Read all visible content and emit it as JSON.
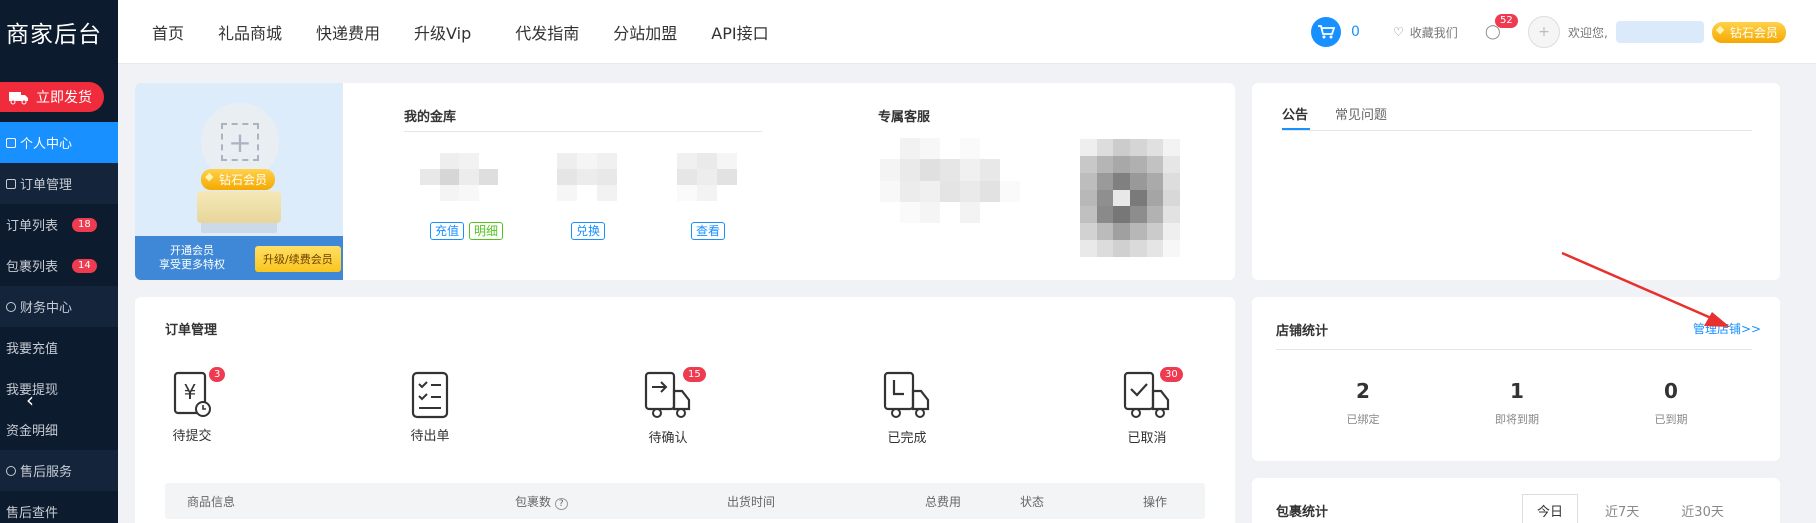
{
  "sidebar": {
    "brand": "商家后台",
    "ship_button": "立即发货",
    "items": [
      {
        "label": "个人中心",
        "active": true,
        "group": false,
        "badge": ""
      },
      {
        "label": "订单管理",
        "group": true,
        "badge": ""
      },
      {
        "label": "订单列表",
        "group": false,
        "badge": "18"
      },
      {
        "label": "包裹列表",
        "group": false,
        "badge": "14"
      },
      {
        "label": "财务中心",
        "group": true,
        "badge": ""
      },
      {
        "label": "我要充值",
        "group": false,
        "badge": ""
      },
      {
        "label": "我要提现",
        "group": false,
        "badge": ""
      },
      {
        "label": "资金明细",
        "group": false,
        "badge": ""
      },
      {
        "label": "售后服务",
        "group": true,
        "badge": ""
      },
      {
        "label": "售后查件",
        "group": false,
        "badge": ""
      }
    ]
  },
  "topnav": [
    "首页",
    "礼品商城",
    "快递费用",
    "升级Vip",
    "代发指南",
    "分站加盟",
    "API接口"
  ],
  "topright": {
    "cart_count": "0",
    "favorite": "收藏我们",
    "msg_count": "52",
    "welcome": "欢迎您,",
    "level": "钻石会员"
  },
  "profile": {
    "level": "钻石会员",
    "open_vip": "开通会员",
    "open_vip_sub": "享受更多特权",
    "upgrade": "升级/续费会员",
    "vault_title": "我的金库",
    "vault_tags": [
      "充值",
      "明细",
      "兑换",
      "查看"
    ],
    "service_title": "专属客服"
  },
  "notice": {
    "tabs": [
      "公告",
      "常见问题"
    ]
  },
  "orders": {
    "title": "订单管理",
    "statuses": [
      {
        "label": "待提交",
        "badge": "3",
        "icon": "yuan-clock-icon"
      },
      {
        "label": "待出单",
        "badge": "",
        "icon": "checklist-icon"
      },
      {
        "label": "待确认",
        "badge": "15",
        "icon": "truck-arrow-icon"
      },
      {
        "label": "已完成",
        "badge": "",
        "icon": "truck-clock-icon"
      },
      {
        "label": "已取消",
        "badge": "30",
        "icon": "truck-check-icon"
      }
    ],
    "columns": [
      "商品信息",
      "包裹数",
      "出货时间",
      "总费用",
      "状态",
      "操作"
    ]
  },
  "store": {
    "title": "店铺统计",
    "manage_link": "管理店铺>>",
    "stats": [
      {
        "value": "2",
        "label": "已绑定"
      },
      {
        "value": "1",
        "label": "即将到期"
      },
      {
        "value": "0",
        "label": "已到期"
      }
    ]
  },
  "packages": {
    "title": "包裹统计",
    "ranges": [
      "今日",
      "近7天",
      "近30天"
    ]
  },
  "colors": {
    "sidebar_bg": "#0d1b2e",
    "accent": "#1890ff",
    "danger": "#ef2b3c",
    "gold": "#f9c61e"
  }
}
